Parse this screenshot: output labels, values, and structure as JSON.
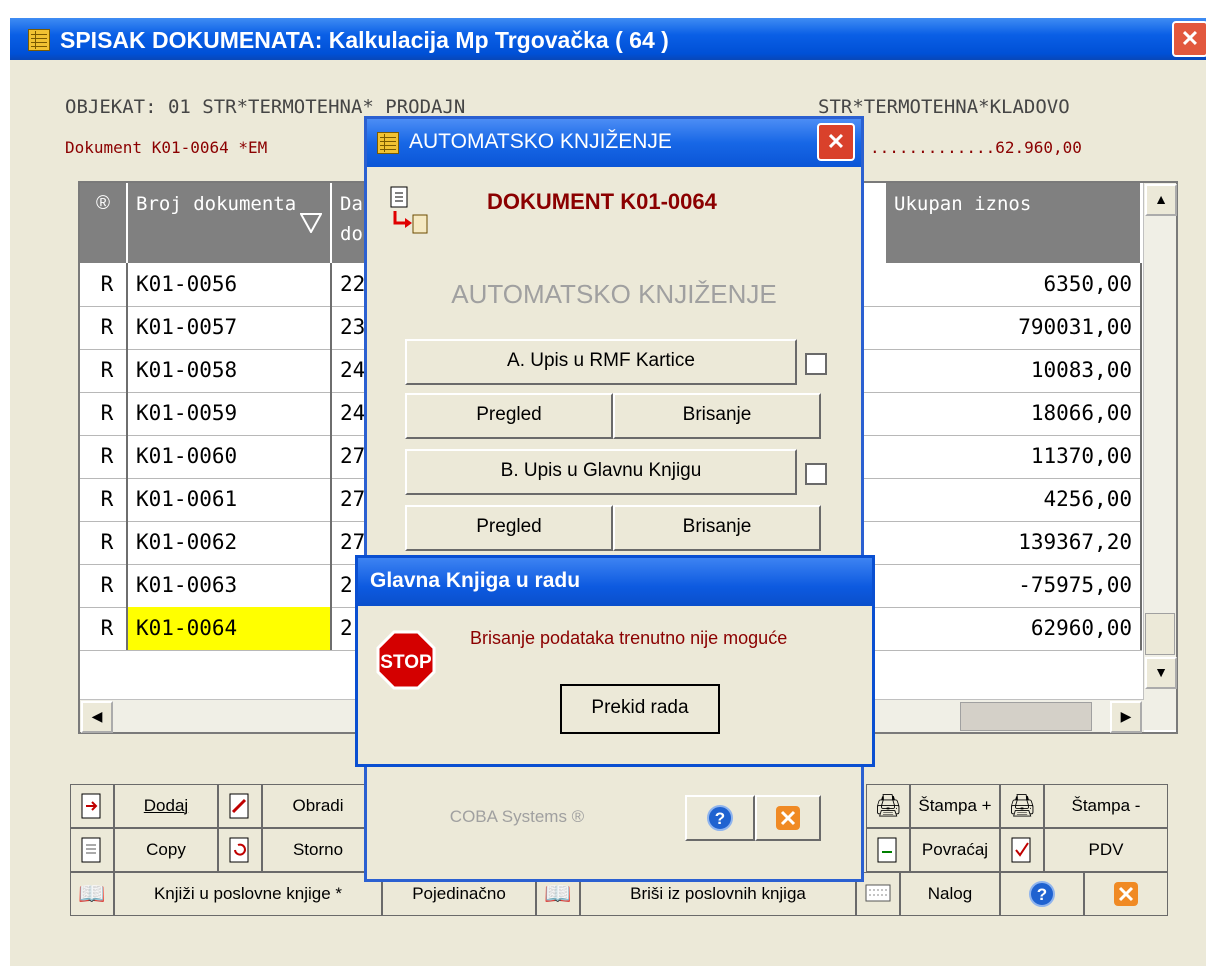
{
  "main": {
    "title": "SPISAK DOKUMENATA:  Kalkulacija Mp Trgovačka  ( 64 )",
    "close": "✕",
    "info_line1_left": "OBJEKAT: 01 STR*TERMOTEHNA* PRODAJN",
    "info_line1_right": "STR*TERMOTEHNA*KLADOVO",
    "info_line2_left": "Dokument K01-0064  *EM",
    "info_line2_right": ".............62.960,00"
  },
  "grid": {
    "headers": {
      "flag": "®",
      "broj": "Broj dokumenta",
      "da": "Da do",
      "ukupan": "Ukupan iznos"
    },
    "rows": [
      {
        "flag": "R",
        "broj": "K01-0056",
        "da": "22",
        "iznos": "6350,00"
      },
      {
        "flag": "R",
        "broj": "K01-0057",
        "da": "23",
        "iznos": "790031,00"
      },
      {
        "flag": "R",
        "broj": "K01-0058",
        "da": "24",
        "iznos": "10083,00"
      },
      {
        "flag": "R",
        "broj": "K01-0059",
        "da": "24",
        "iznos": "18066,00"
      },
      {
        "flag": "R",
        "broj": "K01-0060",
        "da": "27",
        "iznos": "11370,00"
      },
      {
        "flag": "R",
        "broj": "K01-0061",
        "da": "27",
        "iznos": "4256,00"
      },
      {
        "flag": "R",
        "broj": "K01-0062",
        "da": "27",
        "iznos": "139367,20"
      },
      {
        "flag": "R",
        "broj": "K01-0063",
        "da": "2",
        "iznos": "-75975,00"
      },
      {
        "flag": "R",
        "broj": "K01-0064",
        "da": "2",
        "iznos": "62960,00"
      }
    ]
  },
  "toolbar": {
    "dodaj": "Dodaj",
    "obradi": "Obradi",
    "stampa_plus": "Štampa +",
    "stampa_minus": "Štampa -",
    "copy": "Copy",
    "storno": "Storno",
    "povracaj": "Povraćaj",
    "pdv": "PDV",
    "knjizi": "Knjiži u poslovne knjige *",
    "pojedinacno": "Pojedinačno",
    "brisi": "Briši iz poslovnih knjiga",
    "nalog": "Nalog"
  },
  "auto_dialog": {
    "title": "AUTOMATSKO KNJIŽENJE",
    "doc_label": "DOKUMENT  K01-0064",
    "heading": "AUTOMATSKO KNJIŽENJE",
    "btn_a": "A. Upis u RMF Kartice",
    "btn_b": "B. Upis u Glavnu Knjigu",
    "pregled": "Pregled",
    "brisanje": "Brisanje",
    "footer": "COBA Systems ®"
  },
  "glavna_dialog": {
    "title": "Glavna Knjiga u radu",
    "stop": "STOP",
    "message": "Brisanje podataka trenutno nije moguće",
    "button": "Prekid rada"
  },
  "colors": {
    "titlebar": "#0a5fe6",
    "selected_cell": "#ffff00",
    "message_text": "#8b0000",
    "close_red": "#e2583e"
  }
}
